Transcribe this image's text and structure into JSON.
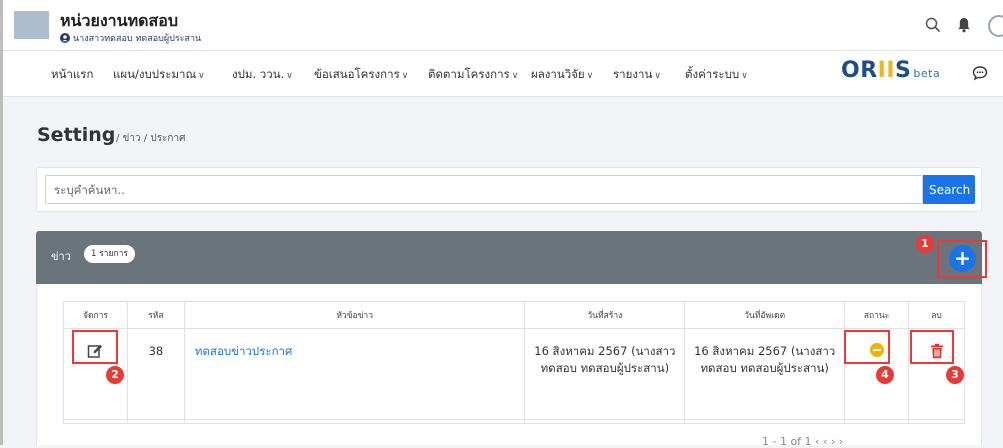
{
  "header": {
    "org_name": "หน่วยงานทดสอบ",
    "user_label": "นางสาวทดสอบ ทดสอบผู้ประสาน",
    "icons": [
      "search-icon",
      "bell-icon",
      "avatar"
    ]
  },
  "nav": {
    "items": [
      {
        "label": "หน้าแรก",
        "dropdown": false
      },
      {
        "label": "แผน/งบประมาณ",
        "dropdown": true
      },
      {
        "label": "งปม. ววน.",
        "dropdown": true
      },
      {
        "label": "ข้อเสนอโครงการ",
        "dropdown": true
      },
      {
        "label": "ติดตามโครงการ",
        "dropdown": true
      },
      {
        "label": "ผลงานวิจัย",
        "dropdown": true
      },
      {
        "label": "รายงาน",
        "dropdown": true
      },
      {
        "label": "ตั้งค่าระบบ",
        "dropdown": true
      }
    ],
    "caret": "∨",
    "brand": {
      "part1": "OR",
      "part2": "II",
      "part3": "S",
      "beta": "beta"
    }
  },
  "page": {
    "title": "Setting",
    "breadcrumb": "/ ข่าว / ประกาศ"
  },
  "search": {
    "placeholder": "ระบุคำค้นหา..",
    "button_label": "Search"
  },
  "news": {
    "label": "ข่าว",
    "count_badge": "1 รายการ",
    "add_label": "+",
    "columns": [
      "จัดการ",
      "รหัส",
      "หัวข้อข่าว",
      "วันที่สร้าง",
      "วันที่อัพเดต",
      "สถานะ",
      "ลบ"
    ],
    "rows": [
      {
        "id": "38",
        "title": "ทดสอบข่าวประกาศ",
        "created": "16 สิงหาคม 2567 (นางสาวทดสอบ ทดสอบผู้ประสาน)",
        "updated": "16 สิงหาคม 2567 (นางสาวทดสอบ ทดสอบผู้ประสาน)",
        "status_color": "#f0b400"
      }
    ],
    "pager_text": "1 - 1 of 1"
  },
  "annotations": [
    "1",
    "2",
    "3",
    "4"
  ],
  "colors": {
    "accent": "#1a73e8",
    "highlight": "#e83a36",
    "card_header": "#6b737b"
  }
}
